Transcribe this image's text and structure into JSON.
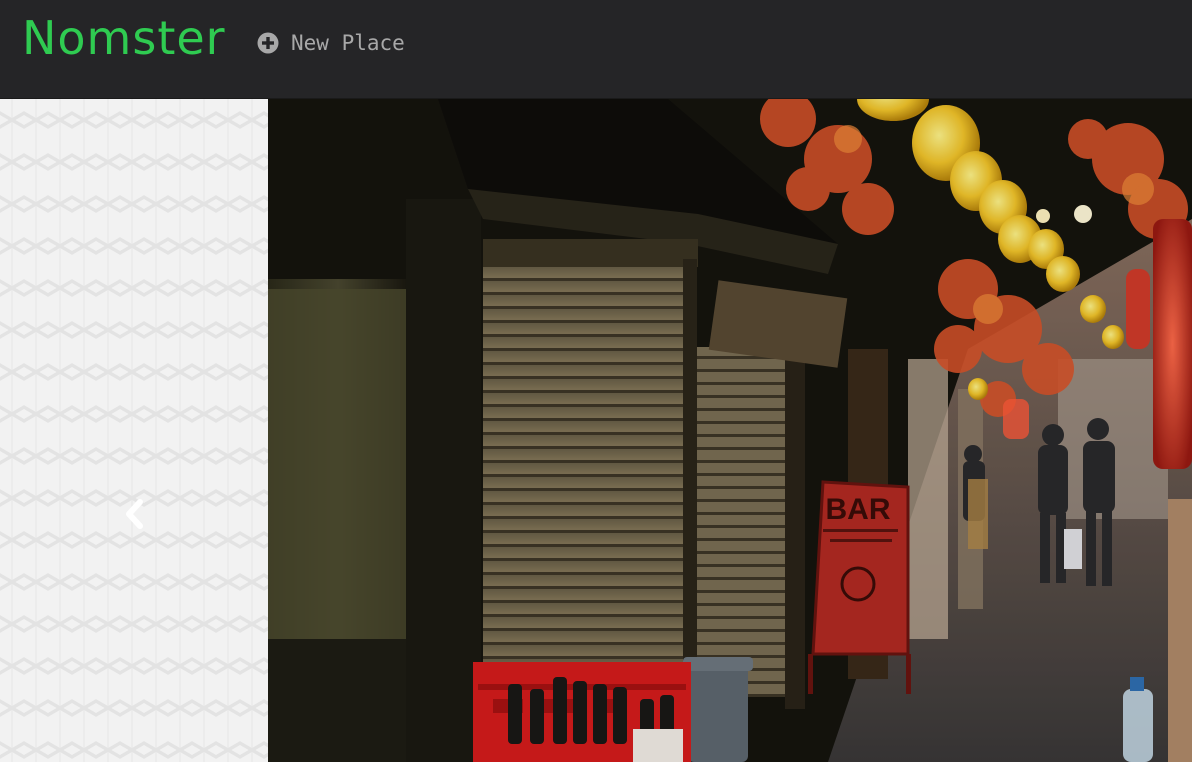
{
  "navbar": {
    "brand": "Nomster",
    "new_place_label": "New Place",
    "new_place_icon": "plus-circle-icon",
    "colors": {
      "background": "#252527",
      "brand": "#2fcb51",
      "link": "#a8a8a8"
    }
  },
  "carousel": {
    "prev_icon": "chevron-left-icon",
    "sign_text": "BAR"
  }
}
